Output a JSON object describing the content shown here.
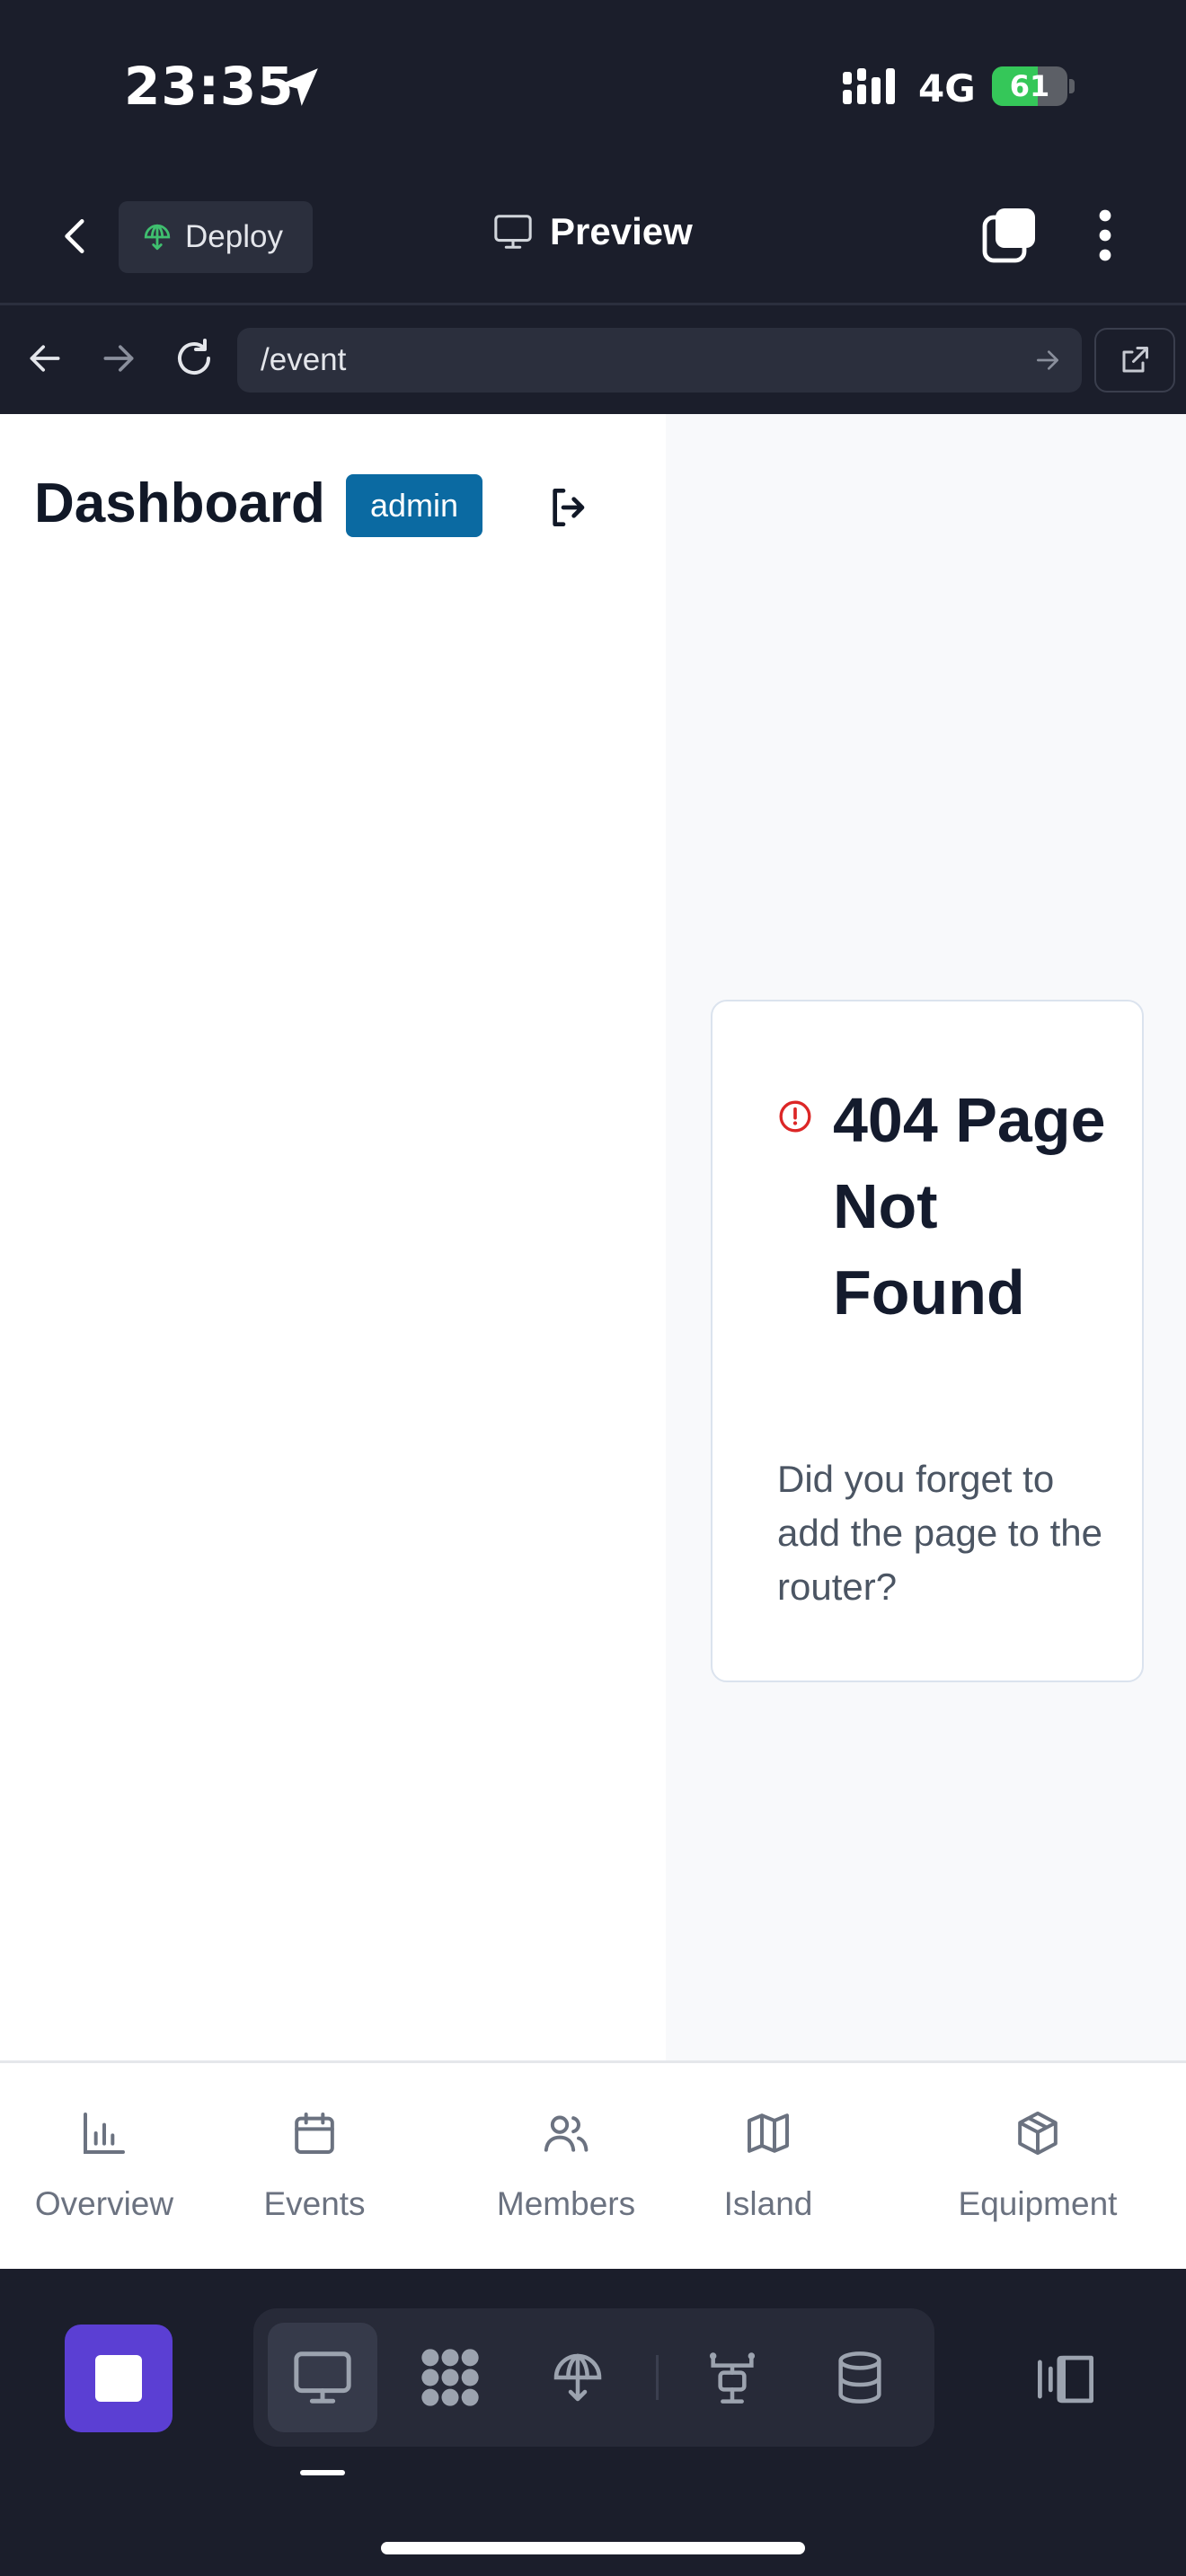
{
  "status_bar": {
    "time": "23:35",
    "network": "4G",
    "battery": "61",
    "battery_level": 0.61
  },
  "header": {
    "deploy_label": "Deploy",
    "title": "Preview"
  },
  "url_bar": {
    "value": "/event"
  },
  "dashboard": {
    "title": "Dashboard",
    "badge": "admin"
  },
  "error": {
    "title": "404 Page Not Found",
    "description": "Did you forget to add the page to the router?"
  },
  "bottom_nav": {
    "items": [
      {
        "label": "Overview",
        "icon": "chart-icon"
      },
      {
        "label": "Events",
        "icon": "calendar-icon"
      },
      {
        "label": "Members",
        "icon": "users-icon"
      },
      {
        "label": "Island",
        "icon": "map-icon"
      },
      {
        "label": "Equipment",
        "icon": "box-icon"
      }
    ]
  },
  "colors": {
    "accent": "#5b3fd3",
    "badge": "#0b6aa2",
    "error": "#dc2626",
    "deploy_icon": "#3fbf6f"
  }
}
